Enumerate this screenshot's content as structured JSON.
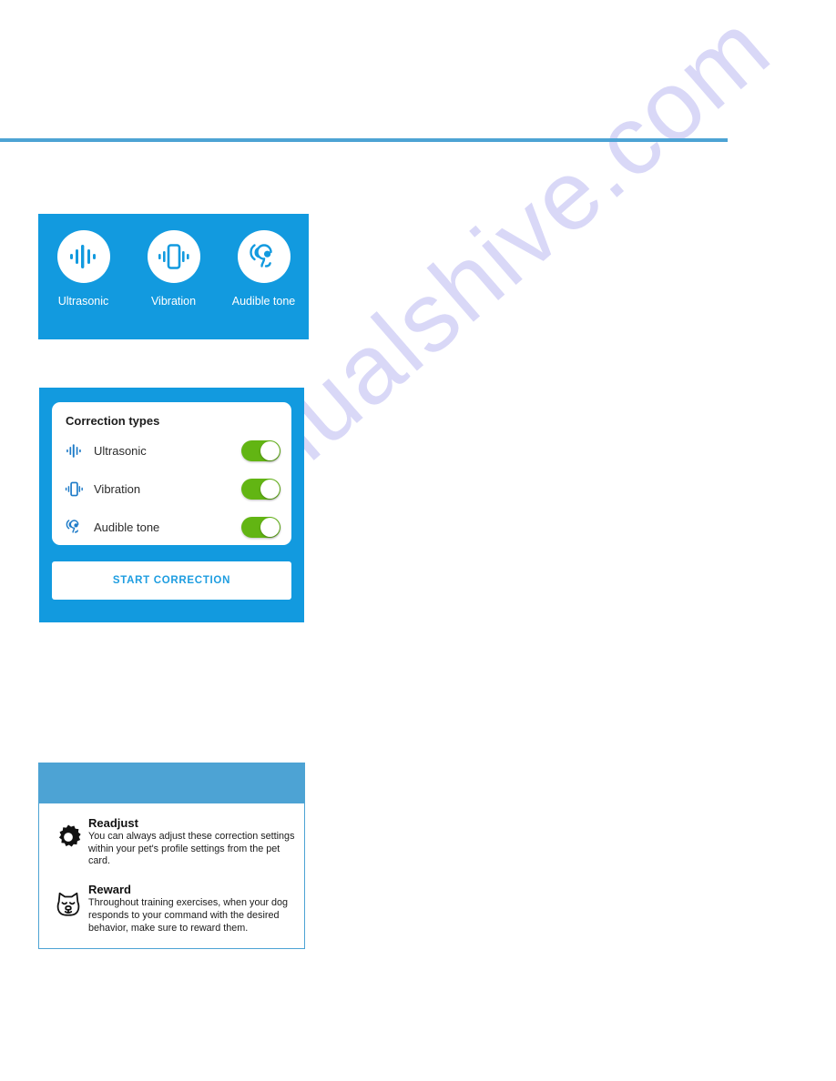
{
  "watermark": {
    "text": "manualshive.com",
    "color": "#d9d8f7"
  },
  "theme": {
    "primary_blue": "#129ADF",
    "rule_blue": "#4da3d4",
    "toggle_green": "#62B513",
    "button_text_blue": "#1E9DE0"
  },
  "icon_panel": {
    "items": [
      {
        "icon": "ultrasonic-waveform-icon",
        "label": "Ultrasonic"
      },
      {
        "icon": "vibration-phone-icon",
        "label": "Vibration"
      },
      {
        "icon": "audible-tone-ear-icon",
        "label": "Audible tone"
      }
    ]
  },
  "correction_card": {
    "title": "Correction types",
    "rows": [
      {
        "icon": "ultrasonic-waveform-icon",
        "label": "Ultrasonic",
        "toggle": "on"
      },
      {
        "icon": "vibration-phone-icon",
        "label": "Vibration",
        "toggle": "on"
      },
      {
        "icon": "audible-tone-ear-icon",
        "label": "Audible tone",
        "toggle": "on"
      }
    ],
    "start_button": "START CORRECTION"
  },
  "tips_panel": {
    "tips": [
      {
        "icon": "gear-icon",
        "title": "Readjust",
        "body": "You can always adjust these correction settings within your pet's profile settings from the pet card."
      },
      {
        "icon": "dog-face-icon",
        "title": "Reward",
        "body": "Throughout training exercises, when your dog responds to your command with the desired behavior, make sure to reward them."
      }
    ]
  }
}
